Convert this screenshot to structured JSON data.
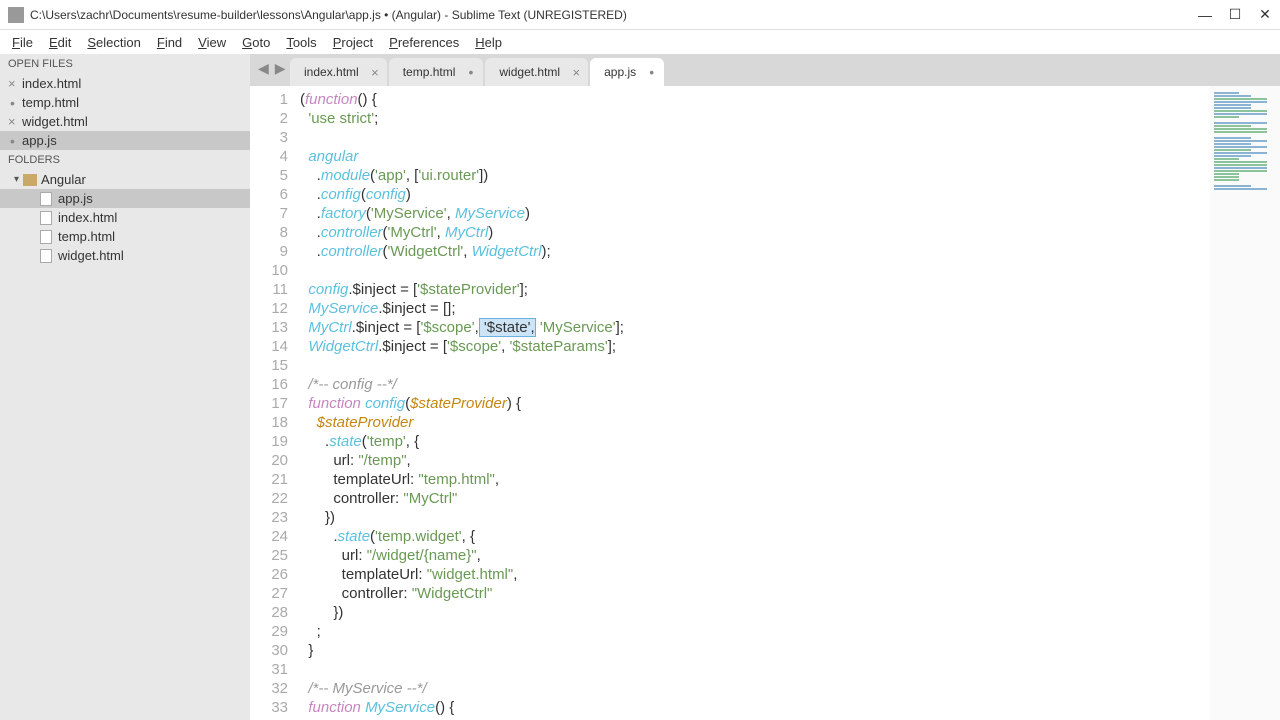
{
  "window": {
    "title": "C:\\Users\\zachr\\Documents\\resume-builder\\lessons\\Angular\\app.js • (Angular) - Sublime Text (UNREGISTERED)"
  },
  "menu": [
    "File",
    "Edit",
    "Selection",
    "Find",
    "View",
    "Goto",
    "Tools",
    "Project",
    "Preferences",
    "Help"
  ],
  "sidebar": {
    "open_files_label": "OPEN FILES",
    "open_files": [
      {
        "name": "index.html",
        "dirty": false
      },
      {
        "name": "temp.html",
        "dirty": true
      },
      {
        "name": "widget.html",
        "dirty": false
      },
      {
        "name": "app.js",
        "dirty": true,
        "active": true
      }
    ],
    "folders_label": "FOLDERS",
    "folder_name": "Angular",
    "tree": [
      {
        "name": "app.js",
        "active": true
      },
      {
        "name": "index.html"
      },
      {
        "name": "temp.html"
      },
      {
        "name": "widget.html"
      }
    ]
  },
  "tabs": [
    {
      "label": "index.html",
      "close": true
    },
    {
      "label": "temp.html",
      "dirty": true
    },
    {
      "label": "widget.html",
      "close": true
    },
    {
      "label": "app.js",
      "dirty": true,
      "active": true
    }
  ],
  "code": {
    "lines": [
      {
        "n": 1,
        "segs": [
          {
            "t": "("
          },
          {
            "t": "function",
            "c": "kw"
          },
          {
            "t": "() {"
          }
        ]
      },
      {
        "n": 2,
        "segs": [
          {
            "t": "  "
          },
          {
            "t": "'use strict'",
            "c": "str"
          },
          {
            "t": ";"
          }
        ]
      },
      {
        "n": 3,
        "segs": [
          {
            "t": ""
          }
        ]
      },
      {
        "n": 4,
        "segs": [
          {
            "t": "  "
          },
          {
            "t": "angular",
            "c": "ident"
          }
        ]
      },
      {
        "n": 5,
        "segs": [
          {
            "t": "    ."
          },
          {
            "t": "module",
            "c": "fn-name"
          },
          {
            "t": "("
          },
          {
            "t": "'app'",
            "c": "str"
          },
          {
            "t": ", ["
          },
          {
            "t": "'ui.router'",
            "c": "str"
          },
          {
            "t": "])"
          }
        ]
      },
      {
        "n": 6,
        "segs": [
          {
            "t": "    ."
          },
          {
            "t": "config",
            "c": "fn-name"
          },
          {
            "t": "("
          },
          {
            "t": "config",
            "c": "ident"
          },
          {
            "t": ")"
          }
        ]
      },
      {
        "n": 7,
        "segs": [
          {
            "t": "    ."
          },
          {
            "t": "factory",
            "c": "fn-name"
          },
          {
            "t": "("
          },
          {
            "t": "'MyService'",
            "c": "str"
          },
          {
            "t": ", "
          },
          {
            "t": "MyService",
            "c": "ident"
          },
          {
            "t": ")"
          }
        ]
      },
      {
        "n": 8,
        "segs": [
          {
            "t": "    ."
          },
          {
            "t": "controller",
            "c": "fn-name"
          },
          {
            "t": "("
          },
          {
            "t": "'MyCtrl'",
            "c": "str"
          },
          {
            "t": ", "
          },
          {
            "t": "MyCtrl",
            "c": "ident"
          },
          {
            "t": ")"
          }
        ]
      },
      {
        "n": 9,
        "segs": [
          {
            "t": "    ."
          },
          {
            "t": "controller",
            "c": "fn-name"
          },
          {
            "t": "("
          },
          {
            "t": "'WidgetCtrl'",
            "c": "str"
          },
          {
            "t": ", "
          },
          {
            "t": "WidgetCtrl",
            "c": "ident"
          },
          {
            "t": ");"
          }
        ]
      },
      {
        "n": 10,
        "segs": [
          {
            "t": ""
          }
        ]
      },
      {
        "n": 11,
        "segs": [
          {
            "t": "  "
          },
          {
            "t": "config",
            "c": "ident"
          },
          {
            "t": ".$inject = ["
          },
          {
            "t": "'$stateProvider'",
            "c": "str"
          },
          {
            "t": "];"
          }
        ]
      },
      {
        "n": 12,
        "segs": [
          {
            "t": "  "
          },
          {
            "t": "MyService",
            "c": "ident"
          },
          {
            "t": ".$inject = [];"
          }
        ]
      },
      {
        "n": 13,
        "segs": [
          {
            "t": "  "
          },
          {
            "t": "MyCtrl",
            "c": "ident"
          },
          {
            "t": ".$inject = ["
          },
          {
            "t": "'$scope'",
            "c": "str"
          },
          {
            "t": ","
          },
          {
            "t": " '$state',",
            "c": "highlight"
          },
          {
            "t": " "
          },
          {
            "t": "'MyService'",
            "c": "str"
          },
          {
            "t": "];"
          }
        ]
      },
      {
        "n": 14,
        "segs": [
          {
            "t": "  "
          },
          {
            "t": "WidgetCtrl",
            "c": "ident"
          },
          {
            "t": ".$inject = ["
          },
          {
            "t": "'$scope'",
            "c": "str"
          },
          {
            "t": ", "
          },
          {
            "t": "'$stateParams'",
            "c": "str"
          },
          {
            "t": "];"
          }
        ]
      },
      {
        "n": 15,
        "segs": [
          {
            "t": ""
          }
        ]
      },
      {
        "n": 16,
        "segs": [
          {
            "t": "  "
          },
          {
            "t": "/*-- config --*/",
            "c": "comment"
          }
        ]
      },
      {
        "n": 17,
        "segs": [
          {
            "t": "  "
          },
          {
            "t": "function",
            "c": "kw"
          },
          {
            "t": " "
          },
          {
            "t": "config",
            "c": "fn-name"
          },
          {
            "t": "("
          },
          {
            "t": "$stateProvider",
            "c": "param"
          },
          {
            "t": ") {"
          }
        ]
      },
      {
        "n": 18,
        "segs": [
          {
            "t": "    "
          },
          {
            "t": "$stateProvider",
            "c": "param"
          }
        ]
      },
      {
        "n": 19,
        "segs": [
          {
            "t": "      ."
          },
          {
            "t": "state",
            "c": "fn-name"
          },
          {
            "t": "("
          },
          {
            "t": "'temp'",
            "c": "str"
          },
          {
            "t": ", {"
          }
        ]
      },
      {
        "n": 20,
        "segs": [
          {
            "t": "        url: "
          },
          {
            "t": "\"/temp\"",
            "c": "str"
          },
          {
            "t": ","
          }
        ]
      },
      {
        "n": 21,
        "segs": [
          {
            "t": "        templateUrl: "
          },
          {
            "t": "\"temp.html\"",
            "c": "str"
          },
          {
            "t": ","
          }
        ]
      },
      {
        "n": 22,
        "segs": [
          {
            "t": "        controller: "
          },
          {
            "t": "\"MyCtrl\"",
            "c": "str"
          }
        ]
      },
      {
        "n": 23,
        "segs": [
          {
            "t": "      })"
          }
        ]
      },
      {
        "n": 24,
        "segs": [
          {
            "t": "        ."
          },
          {
            "t": "state",
            "c": "fn-name"
          },
          {
            "t": "("
          },
          {
            "t": "'temp.widget'",
            "c": "str"
          },
          {
            "t": ", {"
          }
        ]
      },
      {
        "n": 25,
        "segs": [
          {
            "t": "          url: "
          },
          {
            "t": "\"/widget/{name}\"",
            "c": "str"
          },
          {
            "t": ","
          }
        ]
      },
      {
        "n": 26,
        "segs": [
          {
            "t": "          templateUrl: "
          },
          {
            "t": "\"widget.html\"",
            "c": "str"
          },
          {
            "t": ","
          }
        ]
      },
      {
        "n": 27,
        "segs": [
          {
            "t": "          controller: "
          },
          {
            "t": "\"WidgetCtrl\"",
            "c": "str"
          }
        ]
      },
      {
        "n": 28,
        "segs": [
          {
            "t": "        })"
          }
        ]
      },
      {
        "n": 29,
        "segs": [
          {
            "t": "    ;"
          }
        ]
      },
      {
        "n": 30,
        "segs": [
          {
            "t": "  }"
          }
        ]
      },
      {
        "n": 31,
        "segs": [
          {
            "t": ""
          }
        ]
      },
      {
        "n": 32,
        "segs": [
          {
            "t": "  "
          },
          {
            "t": "/*-- MyService --*/",
            "c": "comment"
          }
        ]
      },
      {
        "n": 33,
        "segs": [
          {
            "t": "  "
          },
          {
            "t": "function",
            "c": "kw"
          },
          {
            "t": " "
          },
          {
            "t": "MyService",
            "c": "fn-name"
          },
          {
            "t": "() {"
          }
        ]
      }
    ]
  }
}
